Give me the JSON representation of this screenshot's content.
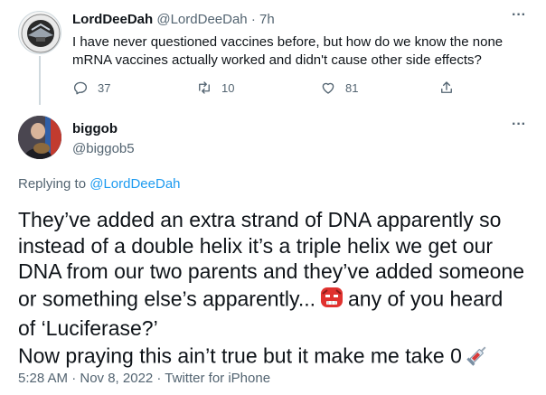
{
  "parent_tweet": {
    "display_name": "LordDeeDah",
    "handle": "@LordDeeDah",
    "separator": "·",
    "time": "7h",
    "text": "I have never questioned vaccines before, but how do we know the none mRNA vaccines actually worked and didn't cause other side effects?",
    "actions": {
      "replies": "37",
      "retweets": "10",
      "likes": "81"
    }
  },
  "main_tweet": {
    "display_name": "biggob",
    "handle": "@biggob5",
    "replying_prefix": "Replying to",
    "replying_to": "@LordDeeDah",
    "text_lines": [
      "They’ve added an extra strand of DNA apparently so",
      "instead of a double helix it’s a triple helix we get our",
      "DNA from our two parents and they’ve added someone",
      "or something else’s apparently...",
      "any of you heard",
      "of ‘Luciferase?’",
      "Now praying this ain’t true but it make me take 0"
    ],
    "emojis": [
      "goblin-emoji",
      "syringe-emoji"
    ],
    "meta": "5:28 AM · Nov 8, 2022 · Twitter for iPhone"
  },
  "colors": {
    "text": "#0f1419",
    "secondary": "#536471",
    "link": "#1d9bf0",
    "divider": "#cfd9de"
  }
}
